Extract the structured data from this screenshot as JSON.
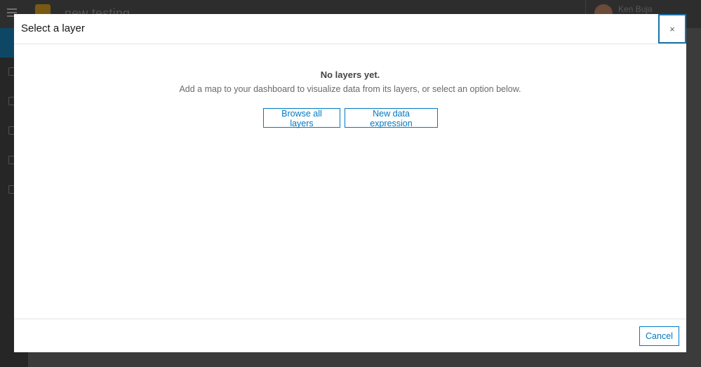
{
  "app": {
    "title": "new testing",
    "user_name": "Ken Buja"
  },
  "modal": {
    "title": "Select a layer",
    "close_symbol": "×",
    "close_label": "Close",
    "empty_heading": "No layers yet.",
    "empty_description": "Add a map to your dashboard to visualize data from its layers, or select an option below.",
    "buttons": {
      "browse_all_layers": "Browse all layers",
      "new_data_expression": "New data expression"
    },
    "footer": {
      "cancel": "Cancel"
    }
  },
  "colors": {
    "accent": "#0079c1",
    "close_focus": "#1a73a8",
    "backdrop": "#3a3a3a"
  },
  "icons": {
    "close": "close-icon",
    "menu": "hamburger-icon",
    "logo": "dashboard-logo-icon"
  }
}
